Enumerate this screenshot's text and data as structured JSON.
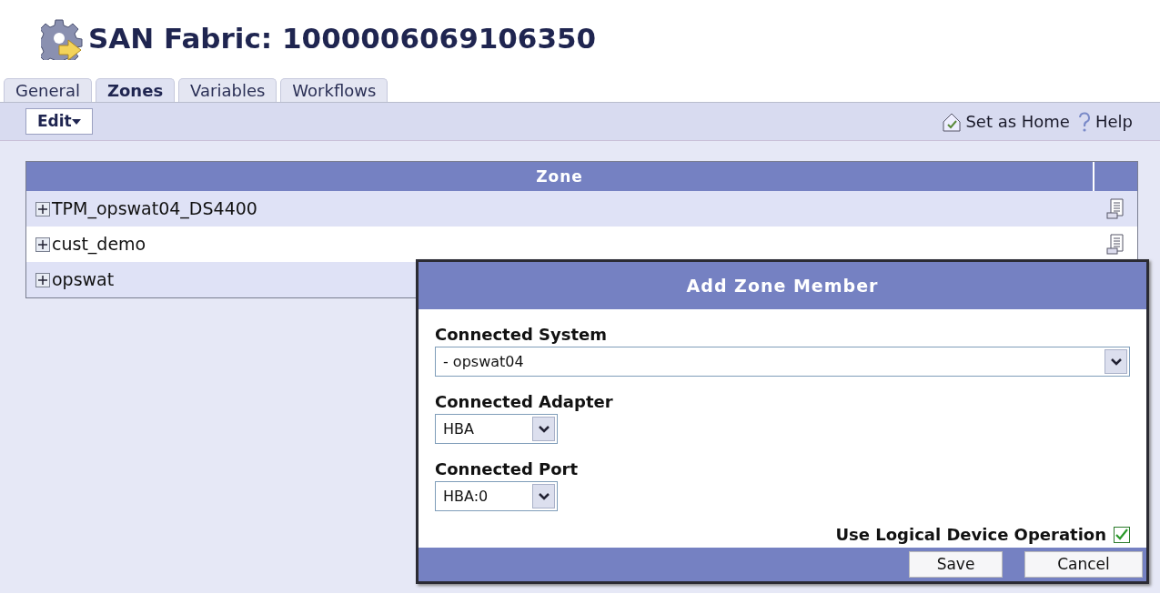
{
  "header": {
    "title": "SAN Fabric: 1000006069106350"
  },
  "tabs": [
    {
      "label": "General",
      "selected": false
    },
    {
      "label": "Zones",
      "selected": true
    },
    {
      "label": "Variables",
      "selected": false
    },
    {
      "label": "Workflows",
      "selected": false
    }
  ],
  "toolbar": {
    "menus": [
      {
        "label": "Edit"
      }
    ],
    "links": [
      {
        "kind": "home",
        "label": "Set as Home"
      },
      {
        "kind": "help",
        "label": "Help"
      }
    ]
  },
  "table": {
    "columns": [
      "Zone"
    ],
    "rows": [
      {
        "name": "TPM_opswat04_DS4400",
        "expanded": false,
        "action_icon": true
      },
      {
        "name": "cust_demo",
        "expanded": false,
        "action_icon": true
      },
      {
        "name": "opswat",
        "expanded": false
      }
    ]
  },
  "dialog": {
    "title": "Add Zone Member",
    "fields": [
      {
        "label": "Connected System",
        "value": "- opswat04",
        "kind": "wide"
      },
      {
        "label": "Connected Adapter",
        "value": "HBA",
        "kind": "narrow"
      },
      {
        "label": "Connected Port",
        "value": "HBA:0",
        "kind": "narrow"
      }
    ],
    "checkbox": {
      "label": "Use Logical Device Operation",
      "checked": true
    },
    "buttons": [
      "Save",
      "Cancel"
    ]
  }
}
